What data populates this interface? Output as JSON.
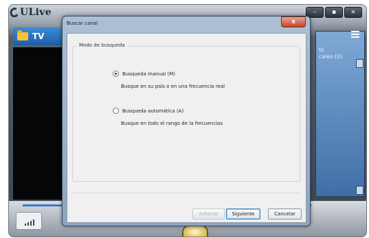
{
  "app": {
    "title": "ULive",
    "tab_label": "TV",
    "window_buttons": [
      "–",
      "▪",
      "×"
    ],
    "right_panel_text": [
      "ts",
      "cales (0)"
    ]
  },
  "dialog": {
    "title": "Buscar canal",
    "close_label": "x",
    "group_label": "Modo de busqueda",
    "options": [
      {
        "label": "Busqueda manual (M)",
        "description": "Busque en su país o en una frecuencia real",
        "checked": true
      },
      {
        "label": "Busqueda automática (A)",
        "description": "Busque en todo el rango de la frecuencias",
        "checked": false
      }
    ],
    "buttons": {
      "back": "Anterior",
      "next": "Siguiente",
      "cancel": "Cancelar"
    }
  }
}
